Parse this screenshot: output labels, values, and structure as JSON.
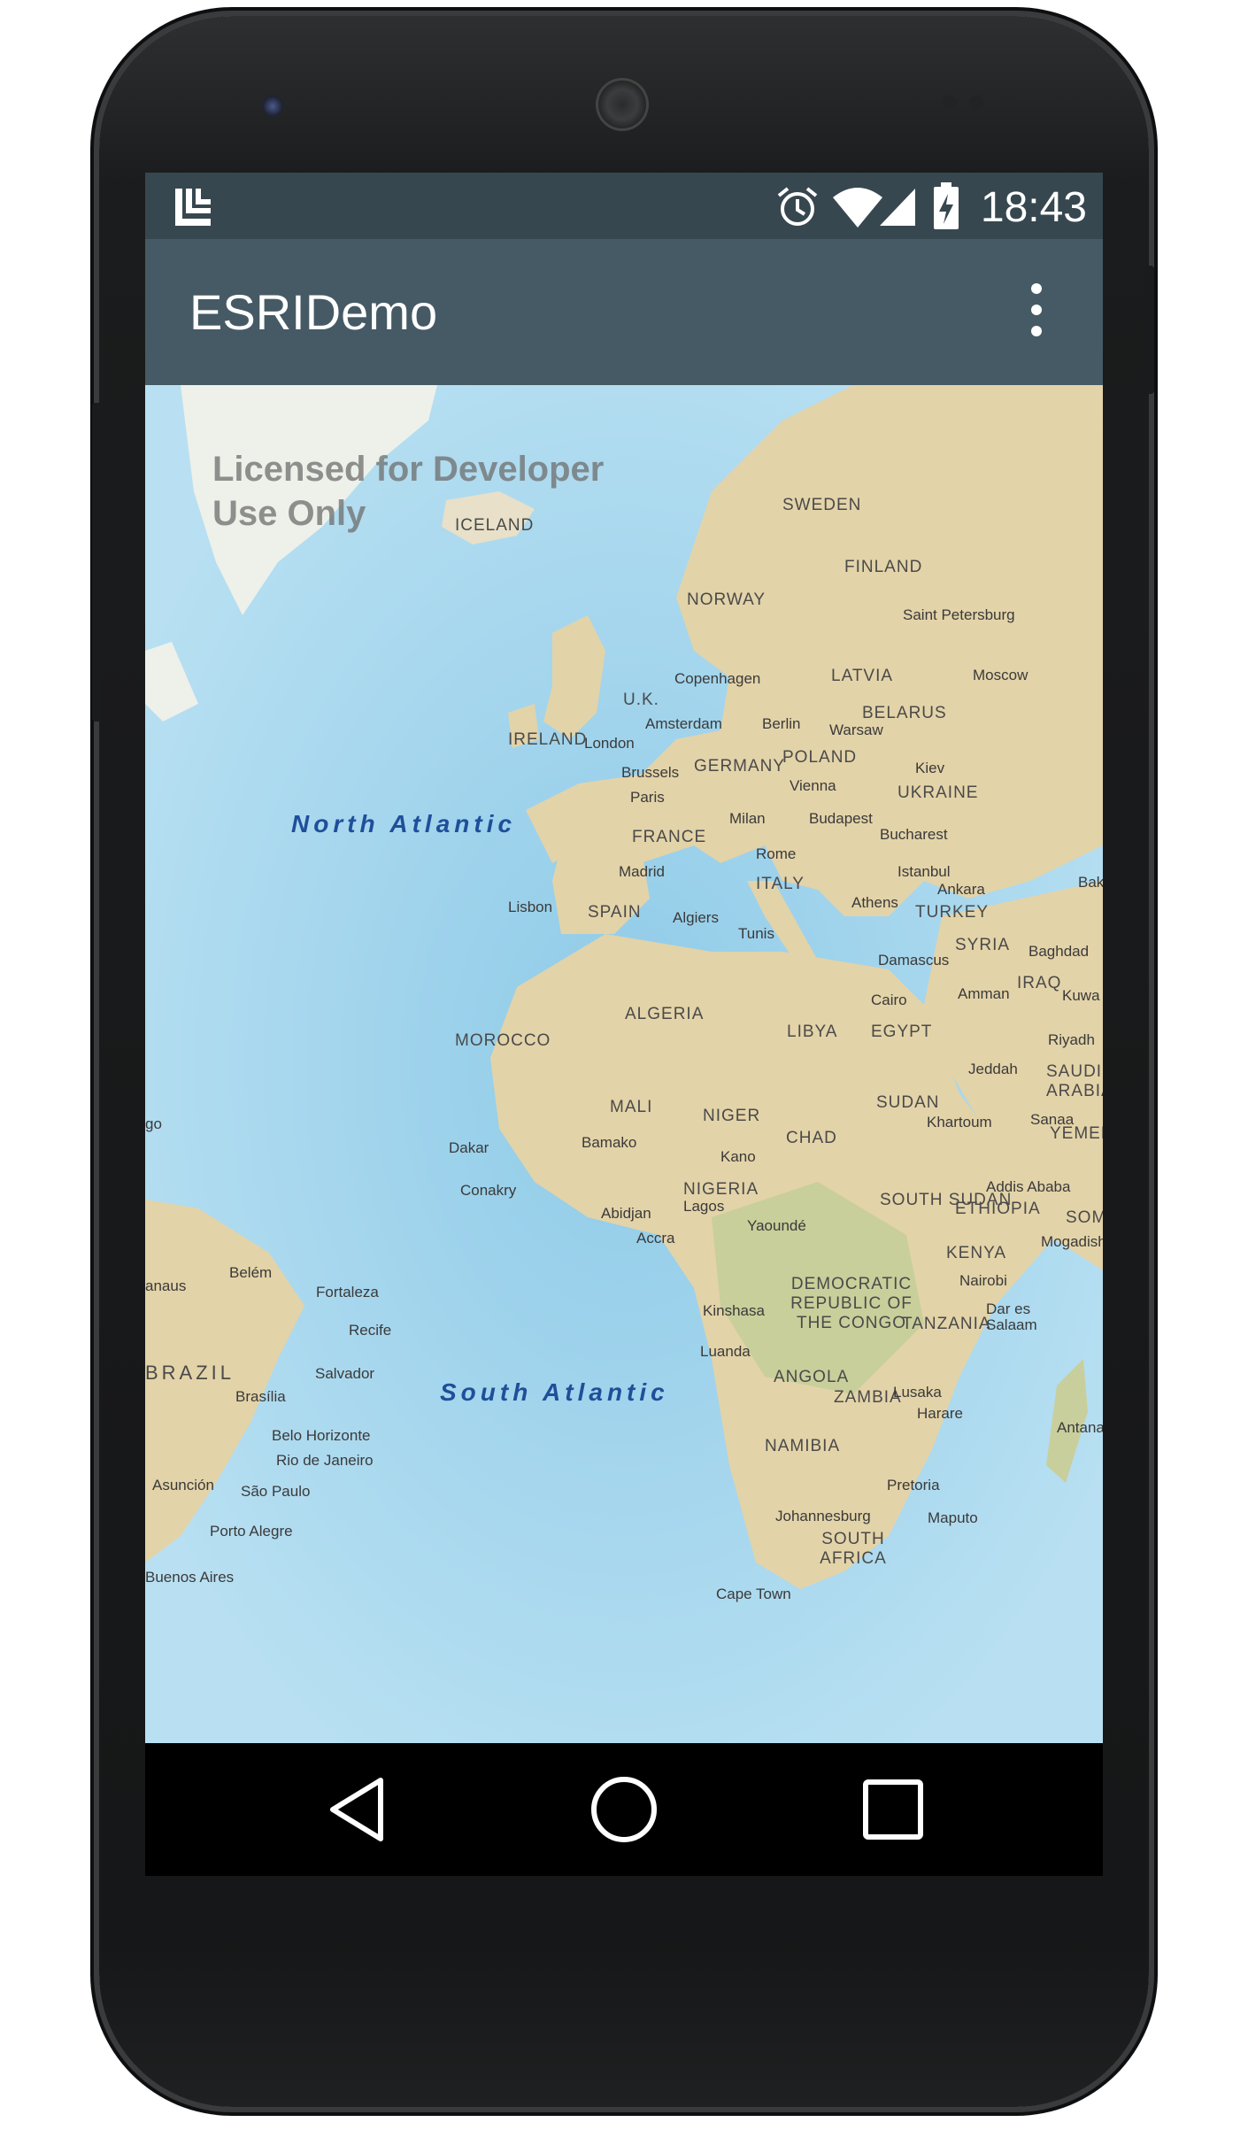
{
  "status_bar": {
    "time": "18:43",
    "icons": [
      "launcher-icon",
      "alarm-icon",
      "wifi-icon",
      "signal-icon",
      "battery-charging-icon"
    ]
  },
  "app_bar": {
    "title": "ESRIDemo",
    "menu_icon": "overflow-menu-icon"
  },
  "map": {
    "watermark": "Licensed for Developer Use Only",
    "oceans": [
      "North Atlantic",
      "South Atlantic"
    ],
    "countries": [
      "SWEDEN",
      "FINLAND",
      "NORWAY",
      "ICELAND",
      "U.K.",
      "IRELAND",
      "LATVIA",
      "BELARUS",
      "POLAND",
      "GERMANY",
      "UKRAINE",
      "FRANCE",
      "SPAIN",
      "ITALY",
      "TURKEY",
      "SYRIA",
      "IRAQ",
      "ALGERIA",
      "LIBYA",
      "EGYPT",
      "MOROCCO",
      "MALI",
      "NIGER",
      "CHAD",
      "SUDAN",
      "SOUTH SUDAN",
      "ETHIOPIA",
      "NIGERIA",
      "KENYA",
      "DEMOCRATIC REPUBLIC OF THE CONGO",
      "TANZANIA",
      "ANGOLA",
      "ZAMBIA",
      "NAMIBIA",
      "SOUTH AFRICA",
      "BRAZIL",
      "SAUDI ARABIA",
      "YEMEN",
      "SOMA"
    ],
    "cities": [
      "Saint Petersburg",
      "Moscow",
      "Copenhagen",
      "Amsterdam",
      "Berlin",
      "Warsaw",
      "London",
      "Brussels",
      "Kiev",
      "Paris",
      "Vienna",
      "Milan",
      "Budapest",
      "Bucharest",
      "Rome",
      "Istanbul",
      "Ankara",
      "Madrid",
      "Lisbon",
      "Algiers",
      "Tunis",
      "Athens",
      "Damascus",
      "Baghdad",
      "Cairo",
      "Amman",
      "Kuwa",
      "Riyadh",
      "Jeddah",
      "Sanaa",
      "Khartoum",
      "Dakar",
      "Bamako",
      "Kano",
      "Addis Ababa",
      "Conakry",
      "Abidjan",
      "Lagos",
      "Accra",
      "Yaoundé",
      "Mogadish",
      "Nairobi",
      "Kinshasa",
      "Dar es Salaam",
      "Luanda",
      "Lusaka",
      "Harare",
      "Pretoria",
      "Maputo",
      "Johannesburg",
      "Cape Town",
      "Belém",
      "Fortaleza",
      "Recife",
      "Salvador",
      "Brasília",
      "Belo Horizonte",
      "Rio de Janeiro",
      "São Paulo",
      "Asunción",
      "Porto Alegre",
      "Buenos Aires",
      "Antana",
      "Bak",
      "anaus",
      "go"
    ]
  },
  "nav_bar": {
    "back": "back-icon",
    "home": "home-icon",
    "recents": "recents-icon"
  }
}
